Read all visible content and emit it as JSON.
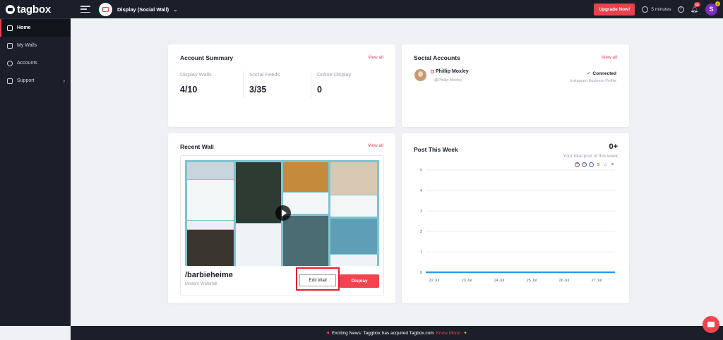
{
  "app": {
    "logo_text": "tagbox"
  },
  "header": {
    "wall_title": "Display (Social Wall)",
    "upgrade_label": "Upgrade Now!",
    "time_text": "5 minutes",
    "notification_count": "10",
    "avatar_letter": "S",
    "avatar_badge": "0"
  },
  "sidebar": {
    "items": [
      {
        "label": "Home",
        "icon": "home-icon",
        "active": true
      },
      {
        "label": "My Walls",
        "icon": "walls-icon"
      },
      {
        "label": "Accounts",
        "icon": "user-icon"
      },
      {
        "label": "Support",
        "icon": "support-icon"
      }
    ]
  },
  "account_summary": {
    "title": "Account Summary",
    "view_all": "View all",
    "stats": [
      {
        "label": "Display Walls",
        "value": "4/10"
      },
      {
        "label": "Social Feeds",
        "value": "3/35"
      },
      {
        "label": "Online Display",
        "value": "0"
      }
    ]
  },
  "social_accounts": {
    "title": "Social Accounts",
    "view_all": "View all",
    "account": {
      "name": "Phillip Moxley",
      "handle": "@Phillip Moxley",
      "status": "Connected",
      "type": "Instagram Business Profile"
    }
  },
  "recent_wall": {
    "title": "Recent Wall",
    "view_all": "View all",
    "wall_name": "/barbieheime",
    "wall_theme": "Modern Waterfall",
    "edit_label": "Edit Wall",
    "display_label": "Display"
  },
  "post_this_week": {
    "title": "Post This Week",
    "count": "0+",
    "subtitle": "Your total post of this week"
  },
  "chart_data": {
    "type": "line",
    "title": "",
    "xlabel": "",
    "ylabel": "",
    "x": [
      "22 Jul",
      "23 Jul",
      "24 Jul",
      "25 Jul",
      "26 Jul",
      "27 Jul"
    ],
    "yticks": [
      0,
      1,
      2,
      3,
      4,
      5
    ],
    "ylim": [
      0,
      5
    ],
    "series": [
      {
        "values": [
          0,
          0,
          0,
          0,
          0,
          0,
          0
        ]
      }
    ],
    "grid": true,
    "color": "#2d9cf0"
  },
  "footer": {
    "news_text": "Exciting News: Taggbox has acquired Tagbox.com",
    "link_text": "Know More!"
  },
  "colors": {
    "accent": "#e8424f",
    "dark": "#1b1f2a",
    "success": "#2bb24c"
  }
}
